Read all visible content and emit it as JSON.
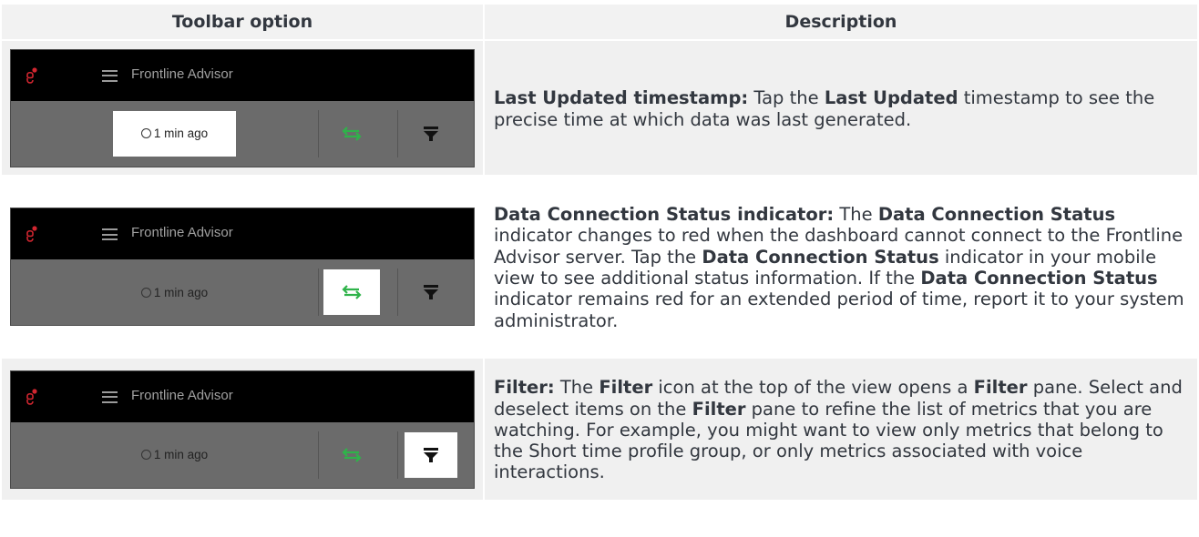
{
  "headers": {
    "col1": "Toolbar option",
    "col2": "Description"
  },
  "mock": {
    "app_title": "Frontline Advisor",
    "timestamp": "1 min ago",
    "colors": {
      "top_bar": "#000000",
      "toolbar": "#6b6b6b",
      "sync_green": "#2fb34a",
      "logo_red": "#d22630"
    }
  },
  "rows": [
    {
      "highlight": "timestamp",
      "parts": [
        {
          "b": "Last Updated timestamp:"
        },
        {
          "t": " Tap the "
        },
        {
          "b": "Last Updated"
        },
        {
          "t": " timestamp to see the precise time at which data was last generated."
        }
      ]
    },
    {
      "highlight": "data-connection-status",
      "parts": [
        {
          "b": "Data Connection Status indicator:"
        },
        {
          "t": " The "
        },
        {
          "b": "Data Connection Status"
        },
        {
          "t": " indicator changes to red when the dashboard cannot connect to the Frontline Advisor server. Tap the "
        },
        {
          "b": "Data Connection Status"
        },
        {
          "t": " indicator in your mobile view to see additional status information. If the "
        },
        {
          "b": "Data Connection Status"
        },
        {
          "t": " indicator remains red for an extended period of time, report it to your system administrator."
        }
      ]
    },
    {
      "highlight": "filter",
      "parts": [
        {
          "b": "Filter:"
        },
        {
          "t": " The "
        },
        {
          "b": "Filter"
        },
        {
          "t": " icon at the top of the view opens a "
        },
        {
          "b": "Filter"
        },
        {
          "t": " pane. Select and deselect items on the "
        },
        {
          "b": "Filter"
        },
        {
          "t": " pane to refine the list of metrics that you are watching. For example, you might want to view only metrics that belong to the Short time profile group, or only metrics associated with voice interactions."
        }
      ]
    }
  ]
}
